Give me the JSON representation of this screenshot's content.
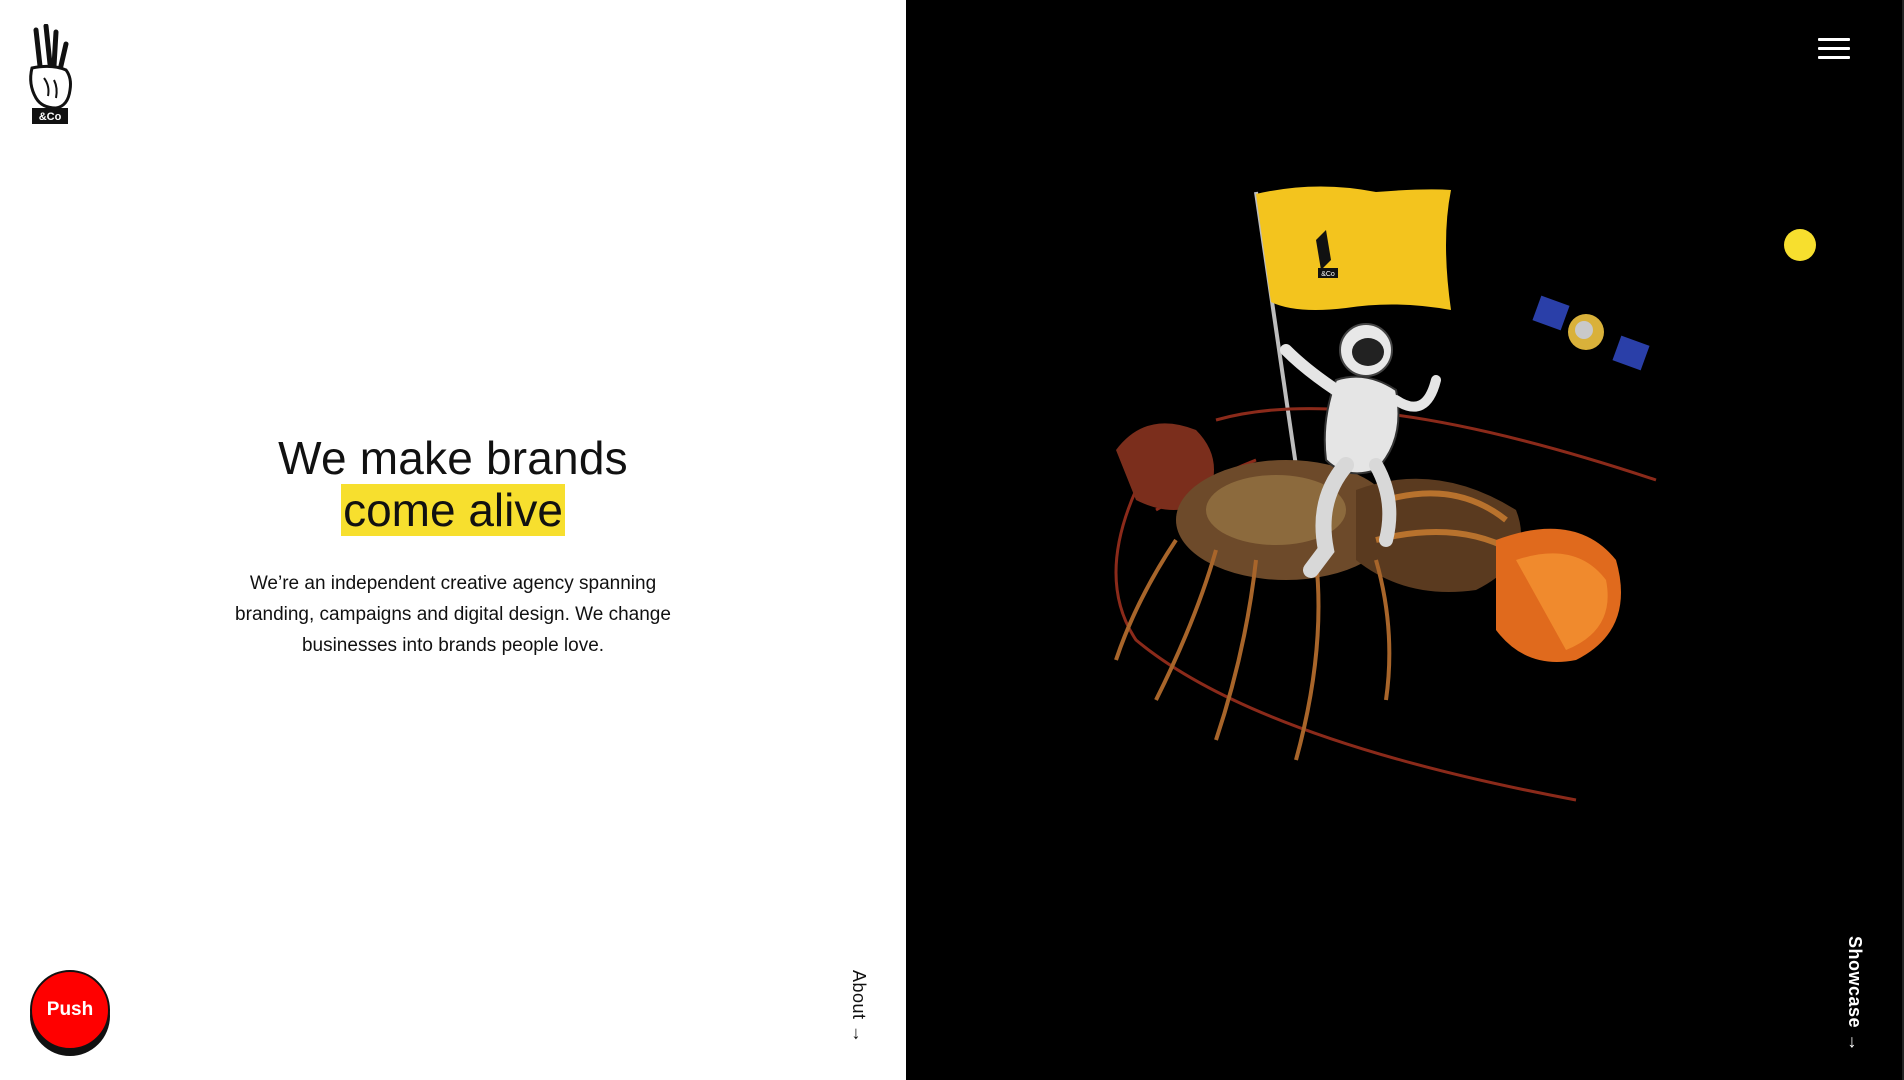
{
  "brand": {
    "logo_text": "&Co"
  },
  "hero": {
    "headline_line1": "We make brands",
    "headline_highlight": "come alive",
    "description": "We’re an independent creative agency spanning branding, campaigns and digital design. We change businesses into brands people love."
  },
  "nav": {
    "about_label": "About →",
    "showcase_label": "Showcase →",
    "menu_icon": "hamburger-icon"
  },
  "push_button": {
    "label": "Push"
  },
  "colors": {
    "accent": "#f7df2e",
    "push_red": "#ff0000",
    "dark_bg": "#000000",
    "light_bg": "#ffffff"
  },
  "illustration": {
    "flag_logo_text": "&Co"
  }
}
